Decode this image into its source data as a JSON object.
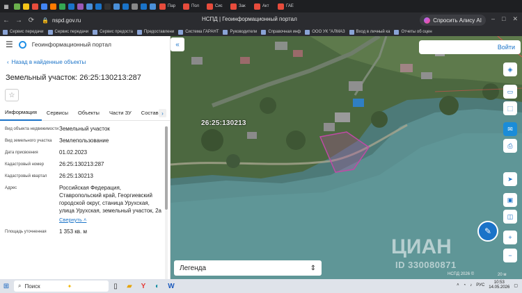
{
  "browser": {
    "tabs": [
      {
        "label": "",
        "color": "#6ab04c"
      },
      {
        "label": "",
        "color": "#f5c518"
      },
      {
        "label": "",
        "color": "#e74c3c"
      },
      {
        "label": "",
        "color": "#4285f4"
      },
      {
        "label": "",
        "color": "#ff7a00"
      },
      {
        "label": "",
        "color": "#34a853"
      },
      {
        "label": "",
        "color": "#1a73c8"
      },
      {
        "label": "",
        "color": "#9b59b6"
      },
      {
        "label": "",
        "color": "#4a90d9"
      },
      {
        "label": "",
        "color": "#1a73c8"
      },
      {
        "label": "",
        "color": "#333333"
      },
      {
        "label": "",
        "color": "#4a90d9"
      },
      {
        "label": "",
        "color": "#1a73c8"
      },
      {
        "label": "",
        "color": "#888888"
      },
      {
        "label": "",
        "color": "#1a73c8"
      },
      {
        "label": "",
        "color": "#4a90d9"
      },
      {
        "label": "Пар",
        "color": "#e74c3c"
      },
      {
        "label": "Пол",
        "color": "#e74c3c"
      },
      {
        "label": "Сис",
        "color": "#e74c3c"
      },
      {
        "label": "Зак",
        "color": "#e74c3c"
      },
      {
        "label": "Акт",
        "color": "#e74c3c"
      },
      {
        "label": "ГАЕ",
        "color": "#e74c3c"
      }
    ],
    "url": "nspd.gov.ru",
    "page_title": "НСПД | Геоинформационный портал",
    "alice_label": "Спросить Алису AI",
    "bookmarks": [
      "Сервис передачи",
      "Сервис передачи",
      "Сервис предоста",
      "Предоставлени",
      "Система ГАРАНТ",
      "Руководители",
      "Справочная инф",
      "ООО УК \"АЛМАЗ",
      "Вход в личный ка",
      "Отчеты об оцен"
    ]
  },
  "panel": {
    "app_title": "Геоинформационный портал",
    "back_label": "Назад в найденные объекты",
    "parcel_title": "Земельный участок: 26:25:130213:287",
    "tabs": [
      "Информация",
      "Сервисы",
      "Объекты",
      "Части ЗУ",
      "Состав"
    ],
    "fields": [
      {
        "label": "Вид объекта недвижимости",
        "value": "Земельный участок"
      },
      {
        "label": "Вид земельного участка",
        "value": "Землепользование"
      },
      {
        "label": "Дата присвоения",
        "value": "01.02.2023"
      },
      {
        "label": "Кадастровый номер",
        "value": "26:25:130213:287"
      },
      {
        "label": "Кадастровый квартал",
        "value": "26:25:130213"
      },
      {
        "label": "Адрес",
        "value": "Российская Федерация, Ставропольский край, Георгиевский городской округ, станица Урухская, улица Урухская, земельный участок, 2а"
      },
      {
        "label": "Площадь уточненная",
        "value": "1 353 кв. м"
      }
    ],
    "collapse_label": "Свернуть"
  },
  "map": {
    "login_label": "Войти",
    "legend_label": "Легенда",
    "cadastral_quarter_label": "26:25:130213",
    "copyright": "НСПД 2026 ©",
    "scale": "20 м",
    "watermark": "ЦИАН",
    "watermark_id": "ID 330080871",
    "parcel_color": "#c04aa6"
  },
  "taskbar": {
    "search_label": "Поиск",
    "lang": "РУС",
    "time": "10:53",
    "date": "14.05.2026"
  }
}
